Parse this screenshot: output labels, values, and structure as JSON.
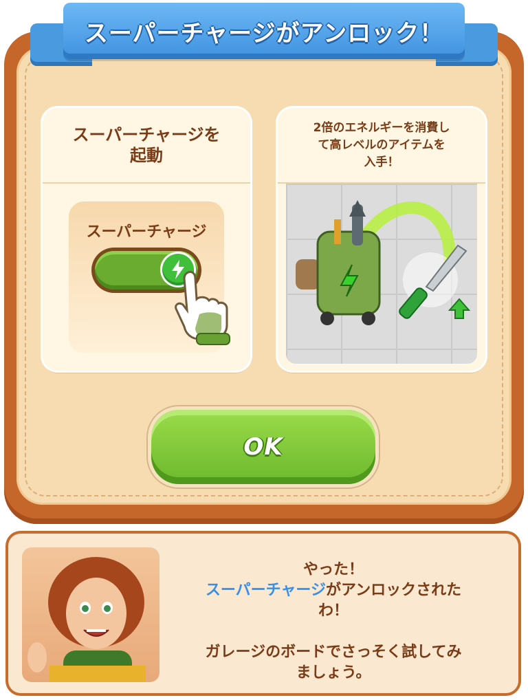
{
  "banner": {
    "title": "スーパーチャージがアンロック！"
  },
  "card_left": {
    "title": "スーパーチャージを\n起動",
    "toggle_label": "スーパーチャージ",
    "toggle_state": "on",
    "toggle_icon": "lightning-icon"
  },
  "card_right": {
    "title": "2倍のエネルギーを消費し\nて高レベルのアイテムを\n入手！",
    "items": [
      "tool-cart",
      "green-knife",
      "level-up-arrow"
    ]
  },
  "ok_button": {
    "label": "OK"
  },
  "dialog": {
    "line1": "やった！",
    "line2_highlight": "スーパーチャージ",
    "line2_rest": "がアンロックされた",
    "line3": "わ！",
    "line4": "ガレージのボードでさっそく試してみ",
    "line5": "ましょう。"
  },
  "colors": {
    "panel_border": "#c5662a",
    "panel_fill": "#f7dcb2",
    "ribbon": "#4a9ae0",
    "ok_green": "#6cb82d",
    "text_brown": "#7a3c17",
    "highlight_blue": "#3b8ee6"
  }
}
